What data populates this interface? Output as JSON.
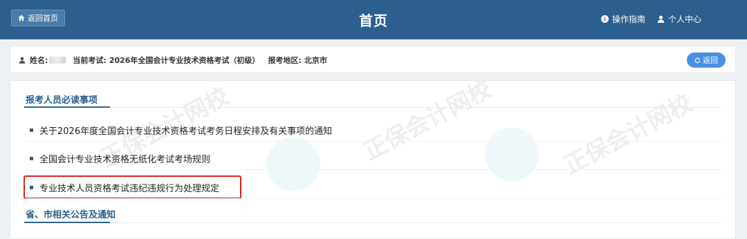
{
  "header": {
    "home_button": "返回首页",
    "title": "首页",
    "guide_link": "操作指南",
    "user_center_link": "个人中心"
  },
  "info_bar": {
    "name_label": "姓名:",
    "exam_label": "当前考试:",
    "exam_value": "2026年全国会计专业技术资格考试（初级）",
    "region_label": "报考地区:",
    "region_value": "北京市",
    "back_button": "返回"
  },
  "sections": [
    {
      "title": "报考人员必读事项",
      "items": [
        "关于2026年度全国会计专业技术资格考试考务日程安排及有关事项的通知",
        "全国会计专业技术资格无纸化考试考场规则",
        "专业技术人员资格考试违纪违规行为处理规定"
      ]
    },
    {
      "title": "省、市相关公告及通知",
      "items": []
    }
  ],
  "colors": {
    "header_bg": "#2c5f8d",
    "accent": "#2c5f8d",
    "back_button": "#4a90e2",
    "highlight_border": "#e02020"
  }
}
